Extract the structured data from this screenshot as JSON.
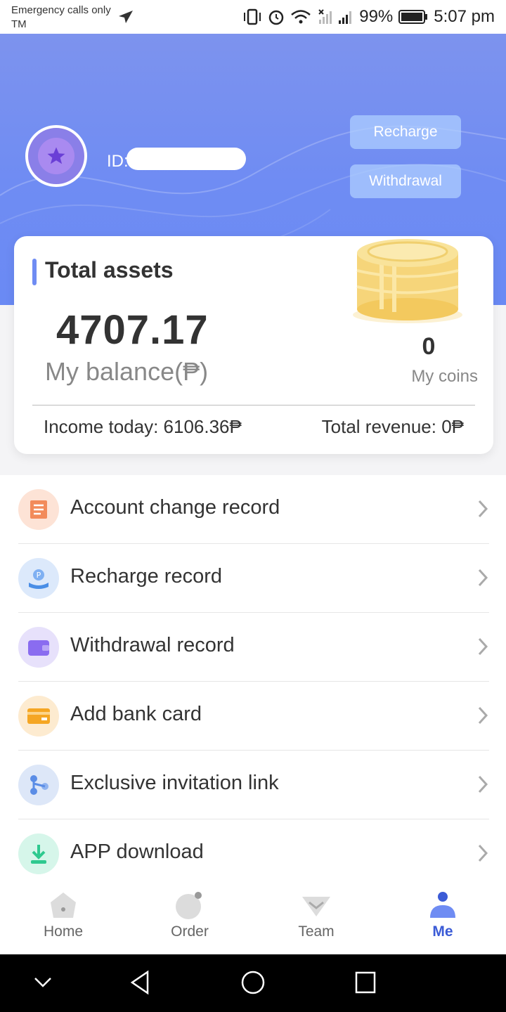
{
  "status_bar": {
    "carrier_line1": "Emergency calls only",
    "carrier_line2": "TM",
    "battery": "99%",
    "time": "5:07 pm"
  },
  "header": {
    "user_id_label": "ID:",
    "recharge_button": "Recharge",
    "withdrawal_button": "Withdrawal"
  },
  "assets": {
    "title": "Total assets",
    "balance": "4707.17",
    "balance_label": "My balance(₱)",
    "coins": "0",
    "coins_label": "My coins",
    "income_today": "Income today: 6106.36₱",
    "total_revenue": "Total revenue: 0₱"
  },
  "menu": {
    "items": [
      {
        "label": "Account change record",
        "icon": "receipt-icon",
        "color": "#f28b5b"
      },
      {
        "label": "Recharge record",
        "icon": "coin-hand-icon",
        "color": "#4a8ee6"
      },
      {
        "label": "Withdrawal record",
        "icon": "wallet-icon",
        "color": "#8a6cf0"
      },
      {
        "label": "Add bank card",
        "icon": "bank-card-icon",
        "color": "#f5a623"
      },
      {
        "label": "Exclusive invitation link",
        "icon": "share-icon",
        "color": "#5b8de6"
      },
      {
        "label": "APP download",
        "icon": "download-icon",
        "color": "#2ec98f"
      }
    ]
  },
  "bottom_nav": {
    "items": [
      {
        "label": "Home",
        "active": false
      },
      {
        "label": "Order",
        "active": false
      },
      {
        "label": "Team",
        "active": false
      },
      {
        "label": "Me",
        "active": true
      }
    ]
  },
  "colors": {
    "accent": "#3b5bd6",
    "header_blue": "#6f8cf3",
    "button_tint": "#aecdff"
  }
}
